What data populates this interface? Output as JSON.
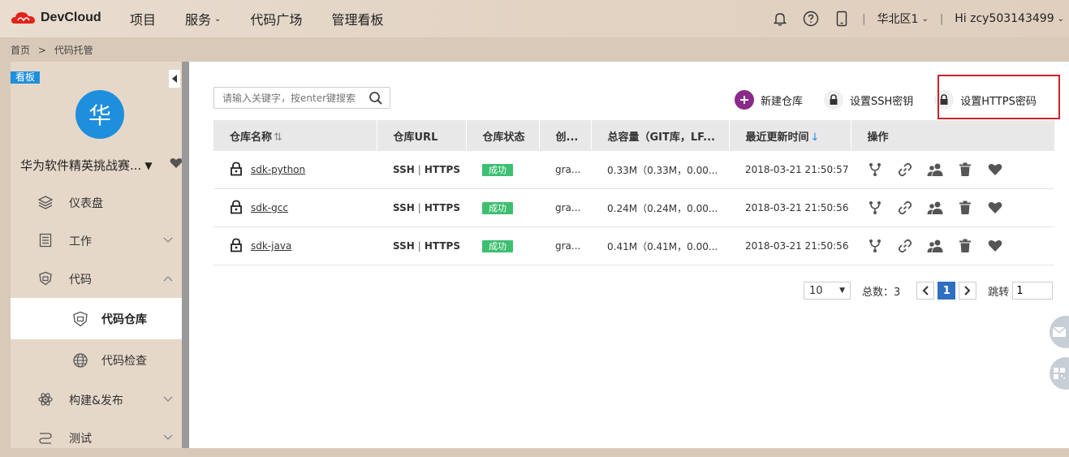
{
  "header": {
    "logo_text": "DevCloud",
    "nav": [
      {
        "label": "项目",
        "has_caret": false
      },
      {
        "label": "服务",
        "has_caret": true
      },
      {
        "label": "代码广场",
        "has_caret": false
      },
      {
        "label": "管理看板",
        "has_caret": false
      }
    ],
    "region": "华北区1",
    "user": "Hi zcy503143499",
    "separator": "|"
  },
  "breadcrumb": {
    "home": "首页",
    "sep": ">",
    "current": "代码托管"
  },
  "sidebar": {
    "board_tag": "看板",
    "avatar_char": "华",
    "project_name": "华为软件精英挑战赛...",
    "menu": [
      {
        "label": "仪表盘",
        "icon": "layers-icon"
      },
      {
        "label": "工作",
        "icon": "list-icon",
        "chevron": "down"
      },
      {
        "label": "代码",
        "icon": "code-shield-icon",
        "chevron": "up"
      }
    ],
    "submenu": [
      {
        "label": "代码仓库",
        "icon": "repo-shield-icon",
        "active": true
      },
      {
        "label": "代码检查",
        "icon": "globe-icon",
        "active": false
      }
    ],
    "menu2": [
      {
        "label": "构建&发布",
        "icon": "atom-icon",
        "chevron": "down"
      },
      {
        "label": "测试",
        "icon": "flow-icon",
        "chevron": "down"
      }
    ]
  },
  "toolbar": {
    "search_placeholder": "请输入关键字，按enter键搜索",
    "new_repo": "新建仓库",
    "ssh_key": "设置SSH密钥",
    "https_pwd": "设置HTTPS密码"
  },
  "table": {
    "columns": [
      "仓库名称",
      "仓库URL",
      "仓库状态",
      "创...",
      "总容量（GIT库，LF...",
      "最近更新时间",
      "操作"
    ],
    "rows": [
      {
        "name": "sdk-python",
        "ssh": "SSH",
        "https": "HTTPS",
        "status": "成功",
        "creator": "gra...",
        "size": "0.33M（0.33M，0.00...",
        "updated": "2018-03-21 21:50:57"
      },
      {
        "name": "sdk-gcc",
        "ssh": "SSH",
        "https": "HTTPS",
        "status": "成功",
        "creator": "gra...",
        "size": "0.24M（0.24M，0.00...",
        "updated": "2018-03-21 21:50:56"
      },
      {
        "name": "sdk-java",
        "ssh": "SSH",
        "https": "HTTPS",
        "status": "成功",
        "creator": "gra...",
        "size": "0.41M（0.41M，0.00...",
        "updated": "2018-03-21 21:50:56"
      }
    ]
  },
  "pager": {
    "page_size": "10",
    "total_label": "总数：3",
    "current_page": "1",
    "jump_label": "跳转",
    "jump_value": "1"
  },
  "colors": {
    "accent": "#1e8fdd",
    "success": "#3dbf70",
    "highlight_border": "#c9242b",
    "new_repo_circle": "#8a2a8a"
  }
}
